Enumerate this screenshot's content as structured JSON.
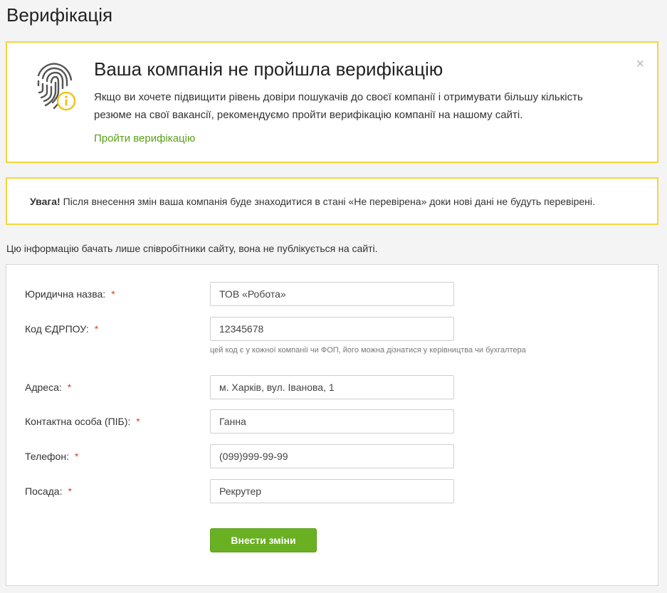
{
  "page": {
    "title": "Верифікація"
  },
  "verification_alert": {
    "title": "Ваша компанія не пройшла верифікацію",
    "text": "Якщо ви хочете підвищити рівень довіри пошукачів до своєї компанії і отримувати більшу кількість резюме на свої вакансії, рекомендуємо пройти верифікацію компанії на нашому сайті.",
    "link": "Пройти верифікацію",
    "close": "×",
    "icon": "fingerprint-info-icon"
  },
  "warning": {
    "strong": "Увага!",
    "text": "Після внесення змін ваша компанія буде знаходитися в стані «Не перевірена» доки нові дані не будуть перевірені."
  },
  "info_text": "Цю інформацію бачать лише співробітники сайту, вона не публікується на сайті.",
  "form": {
    "required_mark": "*",
    "fields": {
      "legal_name": {
        "label": "Юридична назва:",
        "value": "ТОВ «Робота»"
      },
      "edrpou": {
        "label": "Код ЄДРПОУ:",
        "value": "12345678",
        "hint": "цей код є у кожної компанії чи ФОП, його можна дізнатися у керівництва чи бухгалтера"
      },
      "address": {
        "label": "Адреса:",
        "value": "м. Харків, вул. Іванова, 1"
      },
      "contact": {
        "label": "Контактна особа (ПІБ):",
        "value": "Ганна"
      },
      "phone": {
        "label": "Телефон:",
        "value": "(099)999-99-99"
      },
      "position": {
        "label": "Посада:",
        "value": "Рекрутер"
      }
    },
    "submit": "Внести зміни"
  },
  "colors": {
    "accent_border": "#f5d63c",
    "link_green": "#5a9e1a",
    "button_green": "#6ab023",
    "required_red": "#d9402b"
  }
}
